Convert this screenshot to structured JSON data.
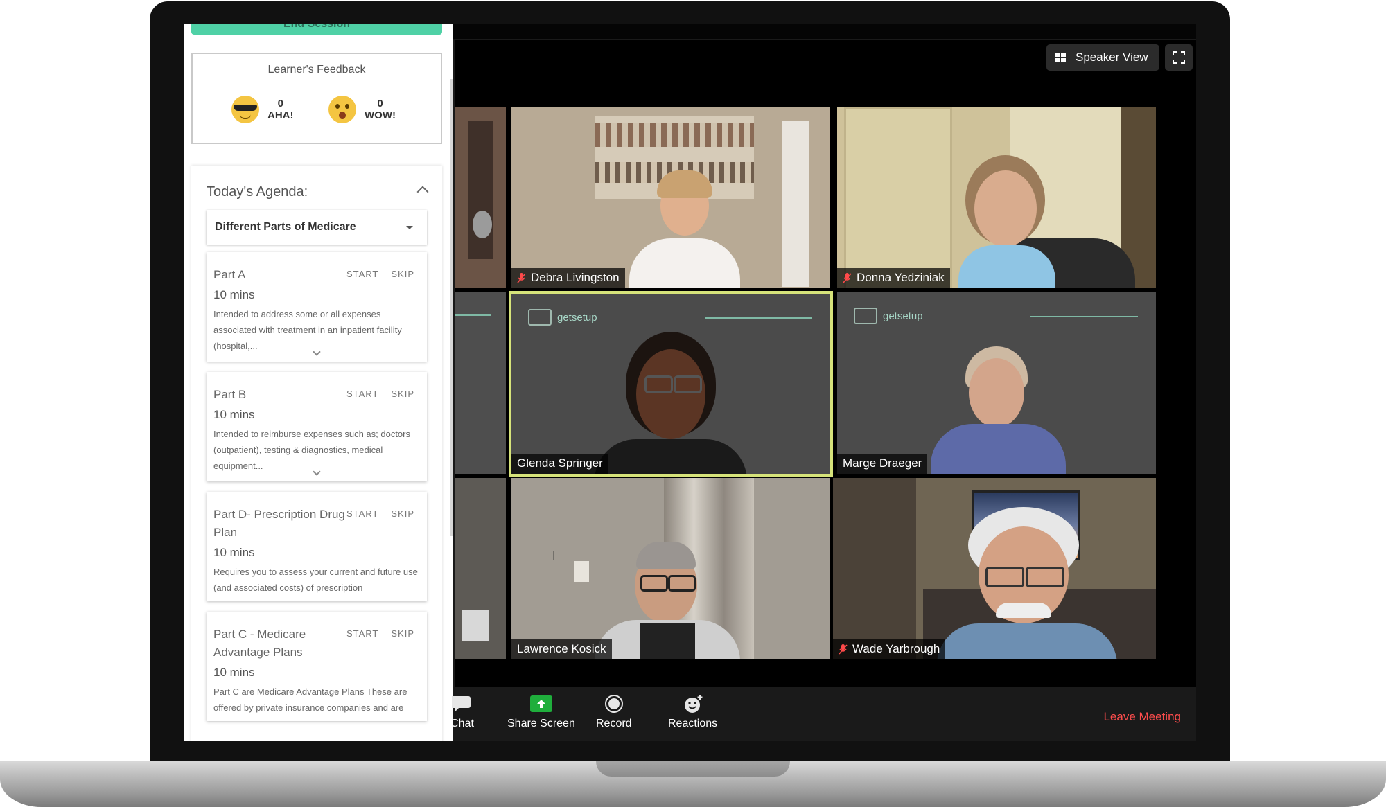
{
  "sidebar": {
    "end_session_label": "End Session",
    "feedback": {
      "title": "Learner's Feedback",
      "items": [
        {
          "count": "0",
          "label": "AHA!",
          "icon": "sunglasses-emoji-icon"
        },
        {
          "count": "0",
          "label": "WOW!",
          "icon": "surprised-emoji-icon"
        }
      ]
    },
    "agenda": {
      "title": "Today's Agenda:",
      "selected": "Different Parts of Medicare",
      "items": [
        {
          "title": "Part A",
          "duration": "10 mins",
          "start": "START",
          "skip": "SKIP",
          "description": "Intended to address some or all expenses associated with treatment in an inpatient facility (hospital,..."
        },
        {
          "title": "Part B",
          "duration": "10 mins",
          "start": "START",
          "skip": "SKIP",
          "description": "Intended to reimburse expenses such as; doctors (outpatient), testing & diagnostics, medical equipment..."
        },
        {
          "title": "Part D- Prescription Drug Plan",
          "duration": "10 mins",
          "start": "START",
          "skip": "SKIP",
          "description": "Requires you to assess your current and future use (and associated costs) of prescription"
        },
        {
          "title": "Part C - Medicare Advantage Plans",
          "duration": "10 mins",
          "start": "START",
          "skip": "SKIP",
          "description": "Part C are Medicare Advantage Plans These are offered by private insurance companies and are"
        }
      ]
    }
  },
  "video": {
    "speaker_view_label": "Speaker View",
    "brand": "getsetup",
    "participants": [
      {
        "name": "Debra Livingston",
        "muted": true
      },
      {
        "name": "Donna Yedziniak",
        "muted": true
      },
      {
        "name": "Glenda Springer",
        "muted": false,
        "active_speaker": true
      },
      {
        "name": "Marge Draeger",
        "muted": false
      },
      {
        "name": "Lawrence Kosick",
        "muted": false
      },
      {
        "name": "Wade Yarbrough",
        "muted": true
      }
    ]
  },
  "toolbar": {
    "chat": "Chat",
    "share_screen": "Share Screen",
    "record": "Record",
    "reactions": "Reactions",
    "leave": "Leave Meeting"
  },
  "colors": {
    "accent_green": "#4fd1a6",
    "active_speaker_border": "#d6e37a",
    "leave_red": "#ff4d4d",
    "share_green": "#1fae3c"
  }
}
